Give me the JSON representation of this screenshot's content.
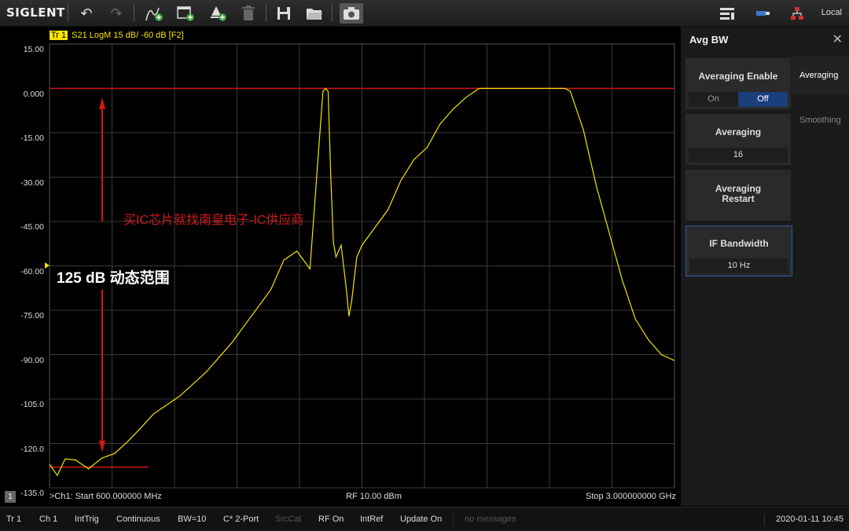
{
  "app": {
    "logo": "SIGLENT",
    "connection": "Local"
  },
  "toolbar": {
    "items": [
      "undo-icon",
      "redo-icon",
      "add-trace-icon",
      "add-window-icon",
      "add-marker-icon",
      "delete-icon",
      "save-icon",
      "open-folder-icon",
      "screenshot-icon"
    ]
  },
  "trace": {
    "badge": "Tr 1",
    "label": "S21 LogM 15 dB/ -60 dB [F2]",
    "color": "#f5e400"
  },
  "y_ticks": [
    "15.00",
    "0.000",
    "-15.00",
    "-30.00",
    "-45.00",
    "-60.00",
    "-75.00",
    "-90.00",
    "-105.0",
    "-120.0",
    "-135.0"
  ],
  "bottom": {
    "channel_badge": "1",
    "start": ">Ch1: Start 600.000000 MHz",
    "power": "RF 10.00 dBm",
    "stop": "Stop 3.000000000 GHz"
  },
  "annotations": {
    "dynamic_range": "125 dB 动态范围",
    "watermark": "买IC芯片就找南皇电子-IC供应商",
    "color": "#d01818"
  },
  "chart_data": {
    "type": "line",
    "x_unit": "GHz",
    "x_range": [
      0.6,
      3.0
    ],
    "ylim": [
      -135,
      15
    ],
    "grid": true,
    "series": [
      {
        "x": [
          0.6,
          0.63,
          0.66,
          0.7,
          0.75,
          0.8,
          0.85,
          0.9,
          0.95,
          1.0,
          1.05,
          1.1,
          1.15,
          1.2,
          1.25,
          1.3,
          1.35,
          1.4,
          1.45,
          1.5,
          1.55,
          1.6,
          1.63,
          1.65,
          1.66,
          1.67,
          1.68,
          1.69,
          1.7,
          1.72,
          1.74,
          1.75,
          1.76,
          1.78,
          1.8,
          1.85,
          1.9,
          1.95,
          2.0,
          2.05,
          2.1,
          2.15,
          2.2,
          2.25,
          2.3,
          2.35,
          2.4,
          2.45,
          2.5,
          2.55,
          2.58,
          2.6,
          2.65,
          2.7,
          2.75,
          2.8,
          2.85,
          2.9,
          2.95,
          3.0
        ],
        "y": [
          -127,
          -130,
          -126,
          -128,
          -127,
          -125,
          -125,
          -117,
          -114,
          -110,
          -107,
          -104,
          -100,
          -96,
          -91,
          -86,
          -80,
          -74,
          -68,
          -58,
          -55,
          -61,
          -25,
          -1,
          0,
          -1,
          -30,
          -52,
          -57,
          -53,
          -68,
          -77,
          -72,
          -57,
          -53,
          -47,
          -41,
          -31,
          -24,
          -20,
          -12,
          -7,
          -3,
          0,
          0,
          0,
          0,
          0,
          0,
          0,
          0,
          -1,
          -14,
          -33,
          -49,
          -65,
          -78,
          -85,
          -90,
          -92
        ]
      }
    ],
    "reference_lines": [
      {
        "y": 0,
        "color": "#d01818"
      },
      {
        "y": -128,
        "x_range": [
          0.6,
          0.98
        ],
        "color": "#d01818"
      }
    ]
  },
  "panel": {
    "title": "Avg BW",
    "tabs": [
      "Averaging",
      "Smoothing"
    ],
    "averaging_enable": {
      "title": "Averaging Enable",
      "on": "On",
      "off": "Off"
    },
    "averaging": {
      "title": "Averaging",
      "value": "16"
    },
    "restart": {
      "title": "Averaging Restart"
    },
    "if_bandwidth": {
      "title": "IF Bandwidth",
      "value": "10 Hz"
    }
  },
  "status": {
    "items": [
      "Tr 1",
      "Ch 1",
      "IntTrig",
      "Continuous",
      "BW=10",
      "C* 2-Port",
      "SrcCal",
      "RF On",
      "IntRef",
      "Update On",
      "no messages"
    ],
    "datetime": "2020-01-11 10:45"
  }
}
